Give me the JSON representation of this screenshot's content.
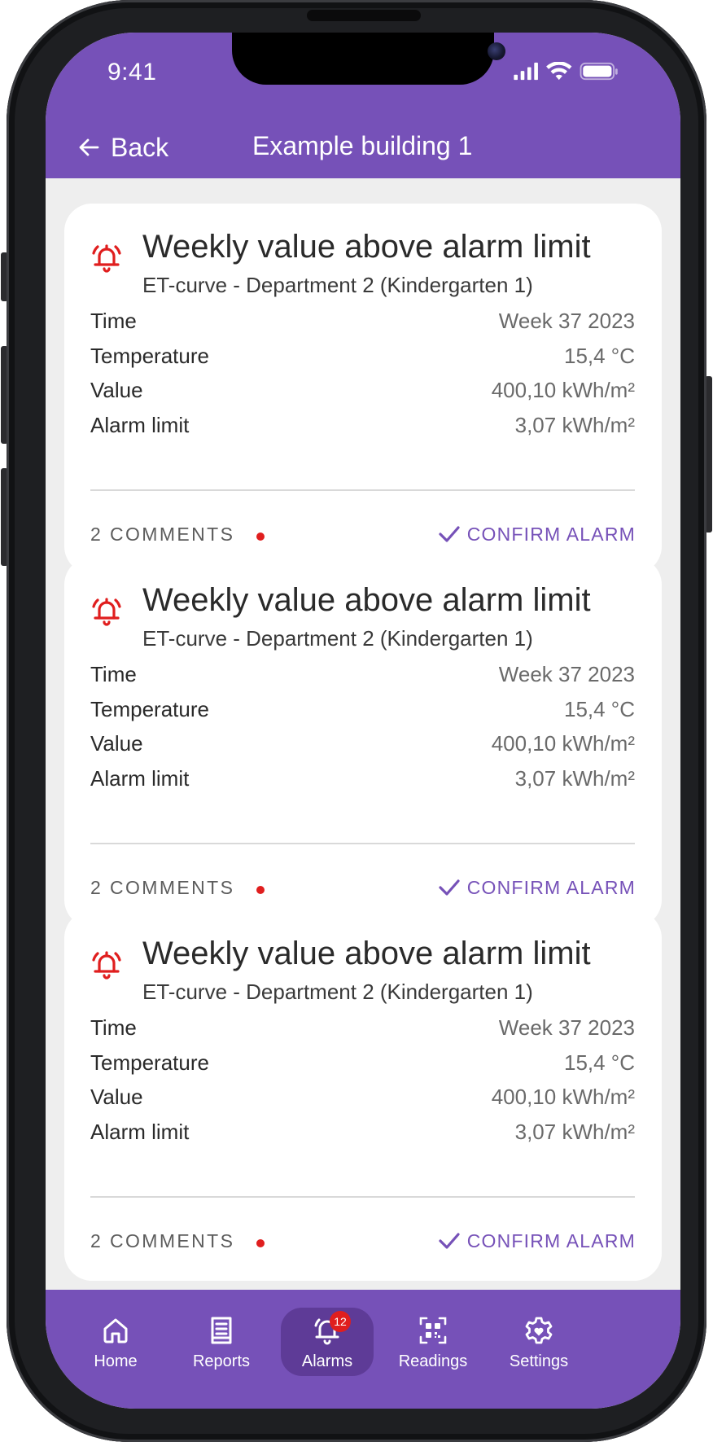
{
  "status_bar": {
    "time": "9:41"
  },
  "header": {
    "back_label": "Back",
    "title": "Example building 1"
  },
  "alarms": [
    {
      "title": "Weekly value above alarm limit",
      "subtitle": "ET-curve - Department 2 (Kindergarten 1)",
      "rows": [
        {
          "label": "Time",
          "value": "Week 37 2023"
        },
        {
          "label": "Temperature",
          "value": "15,4 °C"
        },
        {
          "label": "Value",
          "value": "400,10 kWh/m²"
        },
        {
          "label": "Alarm limit",
          "value": "3,07 kWh/m²"
        }
      ],
      "comments_label": "2 COMMENTS",
      "confirm_label": "CONFIRM ALARM"
    },
    {
      "title": "Weekly value above alarm limit",
      "subtitle": "ET-curve - Department 2 (Kindergarten 1)",
      "rows": [
        {
          "label": "Time",
          "value": "Week 37 2023"
        },
        {
          "label": "Temperature",
          "value": "15,4 °C"
        },
        {
          "label": "Value",
          "value": "400,10 kWh/m²"
        },
        {
          "label": "Alarm limit",
          "value": "3,07 kWh/m²"
        }
      ],
      "comments_label": "2 COMMENTS",
      "confirm_label": "CONFIRM ALARM"
    },
    {
      "title": "Weekly value above alarm limit",
      "subtitle": "ET-curve - Department 2 (Kindergarten 1)",
      "rows": [
        {
          "label": "Time",
          "value": "Week 37 2023"
        },
        {
          "label": "Temperature",
          "value": "15,4 °C"
        },
        {
          "label": "Value",
          "value": "400,10 kWh/m²"
        },
        {
          "label": "Alarm limit",
          "value": "3,07 kWh/m²"
        }
      ],
      "comments_label": "2 COMMENTS",
      "confirm_label": "CONFIRM ALARM"
    }
  ],
  "bottom_nav": [
    {
      "label": "Home",
      "icon": "home-icon"
    },
    {
      "label": "Reports",
      "icon": "report-icon"
    },
    {
      "label": "Alarms",
      "icon": "bell-icon",
      "badge": "12",
      "active": true
    },
    {
      "label": "Readings",
      "icon": "qr-code-icon"
    },
    {
      "label": "Settings",
      "icon": "gear-icon"
    }
  ],
  "colors": {
    "brand_purple": "#7651b8",
    "active_nav": "#5e3b97",
    "alarm_red": "#e01e1e",
    "background": "#eeeeee"
  }
}
